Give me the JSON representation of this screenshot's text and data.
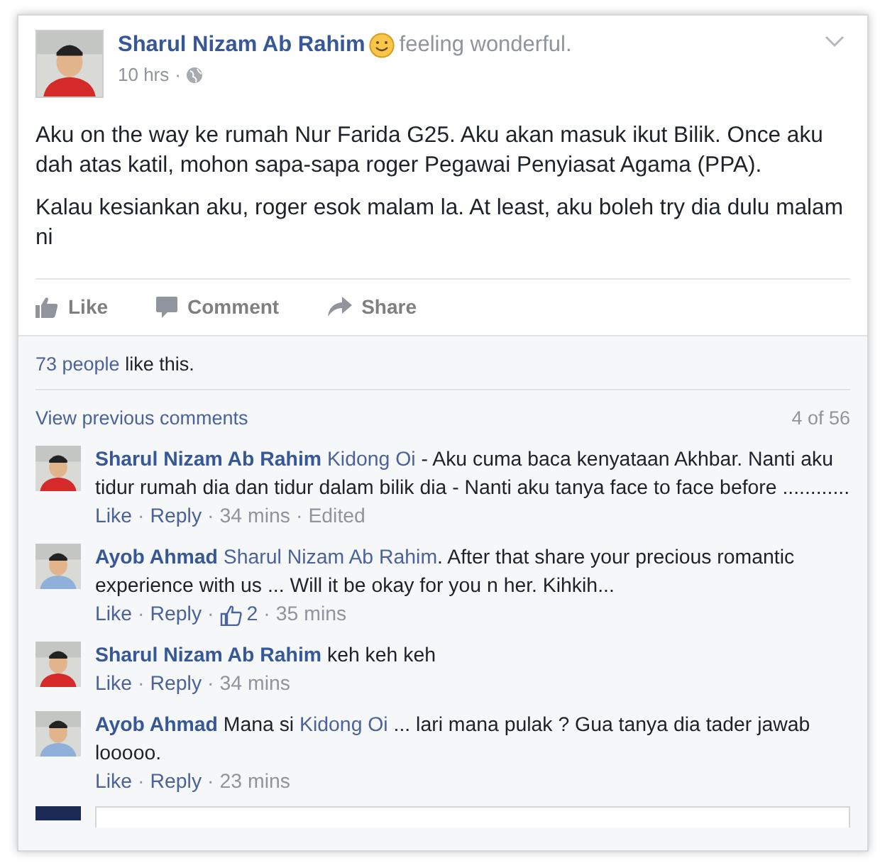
{
  "post": {
    "author": "Sharul Nizam Ab Rahim",
    "color": "#d42a2a",
    "feeling": "feeling wonderful.",
    "time": "10 hrs",
    "dot": "·",
    "paragraphs": [
      "Aku on the way ke rumah Nur Farida G25. Aku akan masuk ikut Bilik. Once aku dah atas katil, mohon sapa-sapa roger Pegawai Penyiasat Agama (PPA).",
      "Kalau kesiankan aku, roger esok malam la. At least, aku boleh try dia dulu malam ni"
    ]
  },
  "actions": [
    {
      "kind": "like",
      "label": "Like"
    },
    {
      "kind": "comment",
      "label": "Comment"
    },
    {
      "kind": "share",
      "label": "Share"
    }
  ],
  "likes": {
    "count": "73 people",
    "text": "like this."
  },
  "previous": {
    "label": "View previous comments",
    "count": "4 of 56"
  },
  "comments": [
    {
      "author": "Sharul Nizam Ab Rahim",
      "color": "#d42a2a",
      "segments": [
        {
          "kind": "mention",
          "text": "Kidong Oi"
        },
        {
          "kind": "plain",
          "text": " - Aku cuma baca kenyataan Akhbar. Nanti aku tidur rumah dia dan tidur dalam bilik dia - Nanti aku tanya face to face before ............"
        }
      ],
      "meta": [
        {
          "kind": "link",
          "text": "Like"
        },
        {
          "kind": "dot",
          "text": "·"
        },
        {
          "kind": "link",
          "text": "Reply"
        },
        {
          "kind": "dot",
          "text": "·"
        },
        {
          "kind": "time",
          "text": "34 mins"
        },
        {
          "kind": "dot",
          "text": "·"
        },
        {
          "kind": "time",
          "text": "Edited"
        }
      ]
    },
    {
      "author": "Ayob Ahmad",
      "color": "#8fb0d8",
      "segments": [
        {
          "kind": "mention",
          "text": "Sharul Nizam Ab Rahim"
        },
        {
          "kind": "plain",
          "text": ". After that share your precious romantic experience with us ... Will it be okay for you n her. Kihkih..."
        }
      ],
      "meta": [
        {
          "kind": "link",
          "text": "Like"
        },
        {
          "kind": "dot",
          "text": "·"
        },
        {
          "kind": "link",
          "text": "Reply"
        },
        {
          "kind": "dot",
          "text": "·"
        },
        {
          "kind": "reactions",
          "text": "2"
        },
        {
          "kind": "dot",
          "text": "·"
        },
        {
          "kind": "time",
          "text": "35 mins"
        }
      ]
    },
    {
      "author": "Sharul Nizam Ab Rahim",
      "color": "#d42a2a",
      "segments": [
        {
          "kind": "plain",
          "text": "keh keh keh"
        }
      ],
      "meta": [
        {
          "kind": "link",
          "text": "Like"
        },
        {
          "kind": "dot",
          "text": "·"
        },
        {
          "kind": "link",
          "text": "Reply"
        },
        {
          "kind": "dot",
          "text": "·"
        },
        {
          "kind": "time",
          "text": "34 mins"
        }
      ]
    },
    {
      "author": "Ayob Ahmad",
      "color": "#8fb0d8",
      "segments": [
        {
          "kind": "plain",
          "text": "Mana si "
        },
        {
          "kind": "mention",
          "text": "Kidong Oi"
        },
        {
          "kind": "plain",
          "text": " ... lari mana pulak ? Gua tanya dia tader jawab looooo."
        }
      ],
      "meta": [
        {
          "kind": "link",
          "text": "Like"
        },
        {
          "kind": "dot",
          "text": "·"
        },
        {
          "kind": "link",
          "text": "Reply"
        },
        {
          "kind": "dot",
          "text": "·"
        },
        {
          "kind": "time",
          "text": "23 mins"
        }
      ]
    }
  ]
}
